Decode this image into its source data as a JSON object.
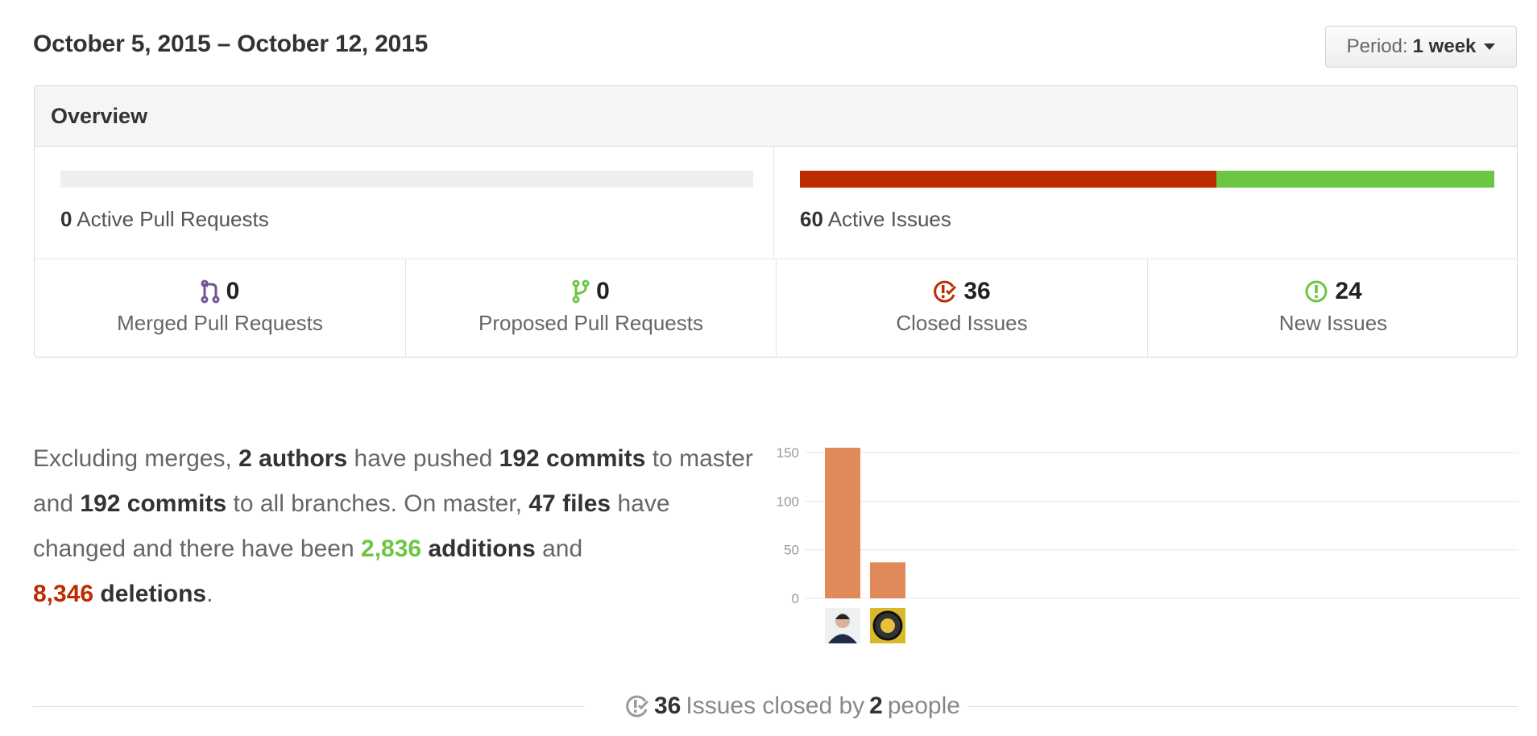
{
  "header": {
    "date_range": "October 5, 2015 – October 12, 2015",
    "period_label": "Period:",
    "period_value": "1 week"
  },
  "overview": {
    "title": "Overview",
    "pull_requests": {
      "count": "0",
      "label": "Active Pull Requests",
      "bar": []
    },
    "issues": {
      "count": "60",
      "label": "Active Issues",
      "bar": [
        {
          "name": "closed",
          "fraction": 0.6,
          "color": "#bd2c00"
        },
        {
          "name": "new",
          "fraction": 0.4,
          "color": "#6cc644"
        }
      ]
    },
    "stats": [
      {
        "icon": "git-merge-icon",
        "value": "0",
        "label": "Merged Pull Requests",
        "color": "#6e5494"
      },
      {
        "icon": "git-pull-request-icon",
        "value": "0",
        "label": "Proposed Pull Requests",
        "color": "#6cc644"
      },
      {
        "icon": "issue-closed-icon",
        "value": "36",
        "label": "Closed Issues",
        "color": "#bd2c00"
      },
      {
        "icon": "issue-opened-icon",
        "value": "24",
        "label": "New Issues",
        "color": "#6cc644"
      }
    ]
  },
  "summary": {
    "p1": "Excluding merges,",
    "authors": "2 authors",
    "p2": "have pushed",
    "commits_master": "192 commits",
    "p3": "to master and",
    "commits_all": "192 commits",
    "p4": "to all branches. On master,",
    "files": "47 files",
    "p5": "have changed and there have been",
    "additions_num": "2,836",
    "additions_word": "additions",
    "p6": "and",
    "deletions_num": "8,346",
    "deletions_word": "deletions",
    "p7": "."
  },
  "chart_data": {
    "type": "bar",
    "categories": [
      "author-1",
      "author-2"
    ],
    "values": [
      155,
      37
    ],
    "yticks": [
      0,
      50,
      100,
      150
    ],
    "ylim": [
      0,
      160
    ],
    "bar_color": "#e08a5a",
    "grid": true,
    "title": "",
    "xlabel": "",
    "ylabel": ""
  },
  "closed_by": {
    "count": "36",
    "text1": "Issues closed by",
    "people": "2",
    "text2": "people"
  }
}
